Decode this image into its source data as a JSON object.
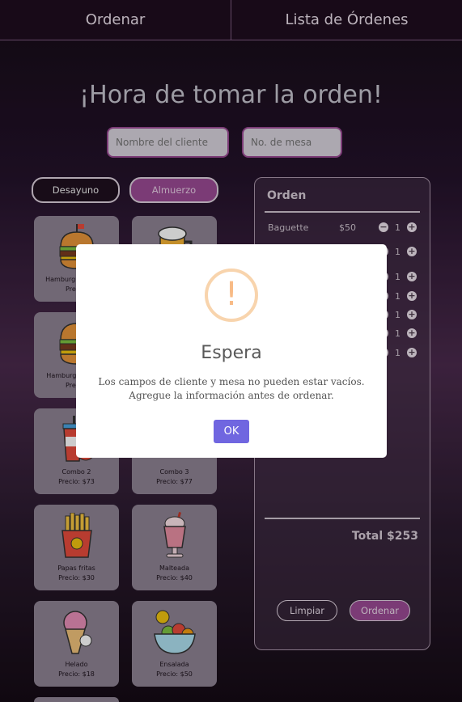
{
  "nav": {
    "order_tab": "Ordenar",
    "orders_list_tab": "Lista de Órdenes"
  },
  "page_title": "¡Hora de tomar la orden!",
  "form": {
    "client_placeholder": "Nombre del cliente",
    "table_placeholder": "No. de mesa",
    "client_value": "",
    "table_value": ""
  },
  "categories": [
    {
      "label": "Desayuno",
      "active": false
    },
    {
      "label": "Almuerzo",
      "active": true
    }
  ],
  "products": [
    {
      "name": "Hamburguesa todo",
      "price": "Precio:",
      "icon": "burger-icon"
    },
    {
      "name": "",
      "price": "",
      "icon": "beer-mug-icon"
    },
    {
      "name": "Hamburguesa clás",
      "price": "Precio:",
      "icon": "burger-icon"
    },
    {
      "name": "",
      "price": "",
      "icon": ""
    },
    {
      "name": "Combo 2",
      "price": "Precio: $73",
      "icon": "soda-combo-icon"
    },
    {
      "name": "Combo 3",
      "price": "Precio: $77",
      "icon": "combo-icon"
    },
    {
      "name": "Papas fritas",
      "price": "Precio: $30",
      "icon": "fries-icon"
    },
    {
      "name": "Malteada",
      "price": "Precio: $40",
      "icon": "milkshake-icon"
    },
    {
      "name": "Helado",
      "price": "Precio: $18",
      "icon": "ice-cream-icon"
    },
    {
      "name": "Ensalada",
      "price": "Precio: $50",
      "icon": "salad-icon"
    }
  ],
  "order": {
    "title": "Orden",
    "items": [
      {
        "name": "Baguette",
        "price": "$50",
        "qty": "1"
      },
      {
        "name": "",
        "price": "",
        "qty": "1"
      },
      {
        "name": "",
        "price": "",
        "qty": "1"
      },
      {
        "name": "",
        "price": "",
        "qty": "1"
      },
      {
        "name": "",
        "price": "",
        "qty": "1"
      },
      {
        "name": "",
        "price": "",
        "qty": "1"
      },
      {
        "name": "",
        "price": "",
        "qty": "1"
      }
    ],
    "total": "Total $253",
    "clear_label": "Limpiar",
    "submit_label": "Ordenar"
  },
  "modal": {
    "icon": "exclamation-icon",
    "icon_glyph": "!",
    "title": "Espera",
    "text": "Los campos de cliente y mesa no pueden estar vacíos. Agregue la información antes de ordenar.",
    "ok_label": "OK"
  },
  "colors": {
    "accent": "#9a4a94",
    "modal_button": "#7066e0",
    "warning": "#f8bb86"
  }
}
